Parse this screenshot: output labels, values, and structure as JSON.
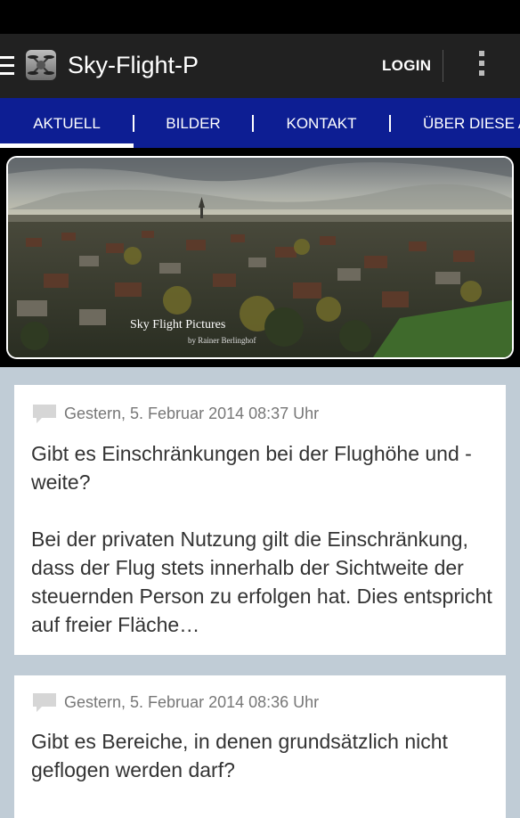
{
  "app": {
    "title": "Sky-Flight-P",
    "login_label": "LOGIN",
    "icons": {
      "menu": "hamburger-icon",
      "app": "drone-app-icon",
      "overflow": "vertical-dots-icon",
      "comment": "speech-bubble-icon"
    }
  },
  "tabs": [
    {
      "label": "AKTUELL",
      "active": true
    },
    {
      "label": "BILDER",
      "active": false
    },
    {
      "label": "KONTAKT",
      "active": false
    },
    {
      "label": "ÜBER DIESE APP",
      "active": false
    }
  ],
  "banner": {
    "title": "Sky Flight Pictures",
    "credit": "by Rainer Berlinghof"
  },
  "posts": [
    {
      "date": "Gestern, 5. Februar 2014 08:37 Uhr",
      "question": "Gibt es Einschränkungen bei der Flughöhe und -weite?",
      "answer": "Bei der privaten Nutzung gilt die Einschränkung, dass der Flug stets innerhalb der Sichtweite der steuernden Person zu erfolgen hat. Dies entspricht auf freier Fläche…"
    },
    {
      "date": "Gestern, 5. Februar 2014 08:36 Uhr",
      "question": "Gibt es Bereiche, in denen grundsätzlich nicht geflogen werden darf?"
    }
  ],
  "colors": {
    "action_bar": "#212121",
    "tab_bar": "#0d1e93",
    "page_background": "#c0ccd6"
  }
}
